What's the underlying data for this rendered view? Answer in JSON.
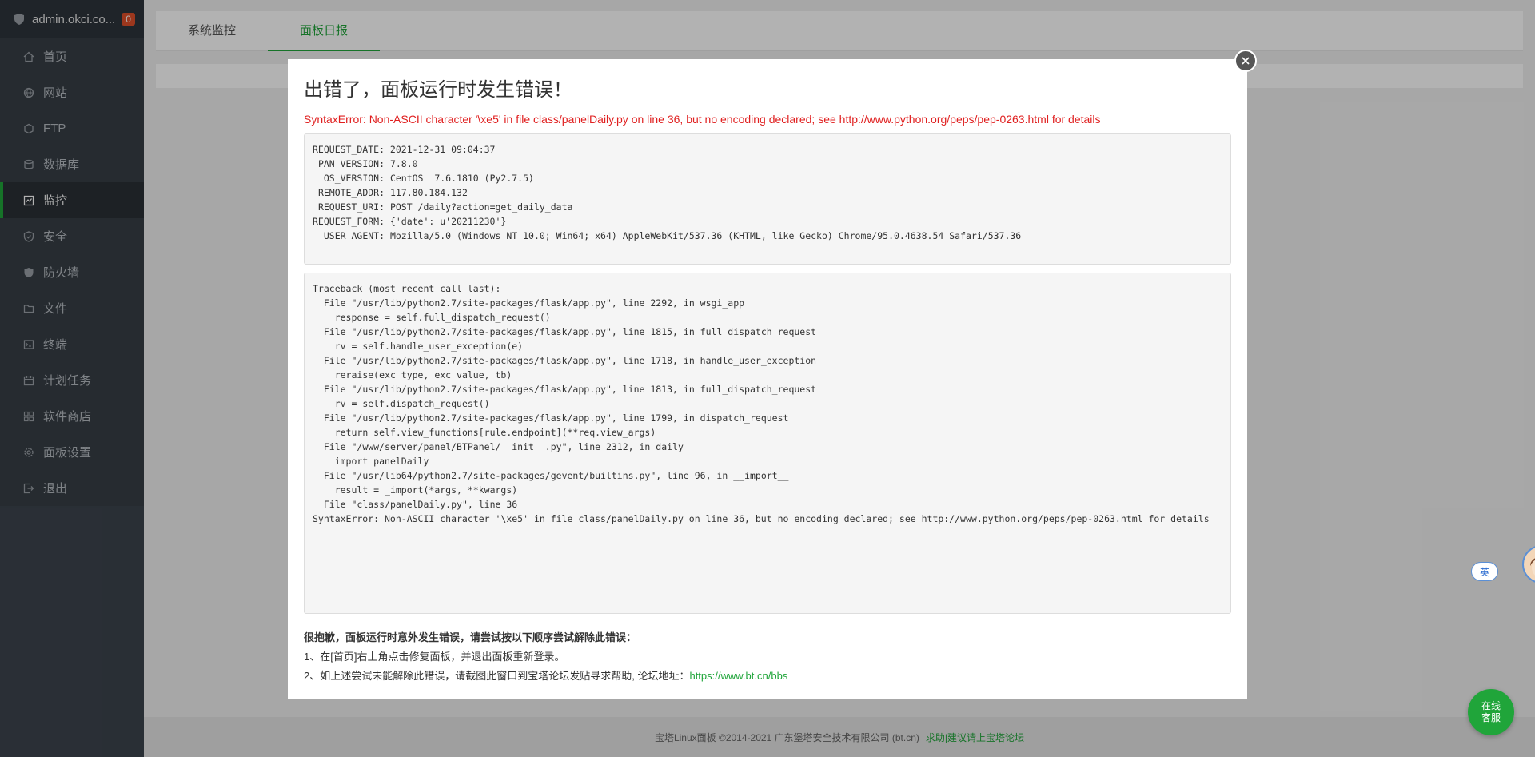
{
  "sidebar": {
    "host": "admin.okci.co...",
    "badge": "0",
    "items": [
      {
        "label": "首页",
        "icon": "home-icon"
      },
      {
        "label": "网站",
        "icon": "globe-icon"
      },
      {
        "label": "FTP",
        "icon": "ftp-icon"
      },
      {
        "label": "数据库",
        "icon": "database-icon"
      },
      {
        "label": "监控",
        "icon": "monitor-icon"
      },
      {
        "label": "安全",
        "icon": "shield-icon"
      },
      {
        "label": "防火墙",
        "icon": "firewall-icon"
      },
      {
        "label": "文件",
        "icon": "folder-icon"
      },
      {
        "label": "终端",
        "icon": "terminal-icon"
      },
      {
        "label": "计划任务",
        "icon": "calendar-icon"
      },
      {
        "label": "软件商店",
        "icon": "apps-icon"
      },
      {
        "label": "面板设置",
        "icon": "gear-icon"
      },
      {
        "label": "退出",
        "icon": "logout-icon"
      }
    ],
    "active_index": 4
  },
  "tabs": [
    {
      "label": "系统监控"
    },
    {
      "label": "面板日报"
    }
  ],
  "modal": {
    "title": "出错了，面板运行时发生错误！",
    "error_line": "SyntaxError: Non-ASCII character '\\xe5' in file class/panelDaily.py on line 36, but no encoding declared; see http://www.python.org/peps/pep-0263.html for details",
    "request_info": "REQUEST_DATE: 2021-12-31 09:04:37\n PAN_VERSION: 7.8.0\n  OS_VERSION: CentOS  7.6.1810 (Py2.7.5)\n REMOTE_ADDR: 117.80.184.132\n REQUEST_URI: POST /daily?action=get_daily_data\nREQUEST_FORM: {'date': u'20211230'}\n  USER_AGENT: Mozilla/5.0 (Windows NT 10.0; Win64; x64) AppleWebKit/537.36 (KHTML, like Gecko) Chrome/95.0.4638.54 Safari/537.36",
    "traceback": "Traceback (most recent call last):\n  File \"/usr/lib/python2.7/site-packages/flask/app.py\", line 2292, in wsgi_app\n    response = self.full_dispatch_request()\n  File \"/usr/lib/python2.7/site-packages/flask/app.py\", line 1815, in full_dispatch_request\n    rv = self.handle_user_exception(e)\n  File \"/usr/lib/python2.7/site-packages/flask/app.py\", line 1718, in handle_user_exception\n    reraise(exc_type, exc_value, tb)\n  File \"/usr/lib/python2.7/site-packages/flask/app.py\", line 1813, in full_dispatch_request\n    rv = self.dispatch_request()\n  File \"/usr/lib/python2.7/site-packages/flask/app.py\", line 1799, in dispatch_request\n    return self.view_functions[rule.endpoint](**req.view_args)\n  File \"/www/server/panel/BTPanel/__init__.py\", line 2312, in daily\n    import panelDaily\n  File \"/usr/lib64/python2.7/site-packages/gevent/builtins.py\", line 96, in __import__\n    result = _import(*args, **kwargs)\n  File \"class/panelDaily.py\", line 36\nSyntaxError: Non-ASCII character '\\xe5' in file class/panelDaily.py on line 36, but no encoding declared; see http://www.python.org/peps/pep-0263.html for details",
    "notes_title": "很抱歉，面板运行时意外发生错误，请尝试按以下顺序尝试解除此错误：",
    "note1": "1、在[首页]右上角点击修复面板，并退出面板重新登录。",
    "note2_prefix": "2、如上述尝试未能解除此错误，请截图此窗口到宝塔论坛发贴寻求帮助, 论坛地址：",
    "note2_link": "https://www.bt.cn/bbs"
  },
  "footer": {
    "copyright": "宝塔Linux面板 ©2014-2021 广东堡塔安全技术有限公司 (bt.cn)",
    "link": "求助|建议请上宝塔论坛"
  },
  "widgets": {
    "lang": "英",
    "chat_line1": "在线",
    "chat_line2": "客服"
  },
  "colors": {
    "accent": "#20a53a",
    "error": "#e02020",
    "sidebar": "#3c444d"
  }
}
